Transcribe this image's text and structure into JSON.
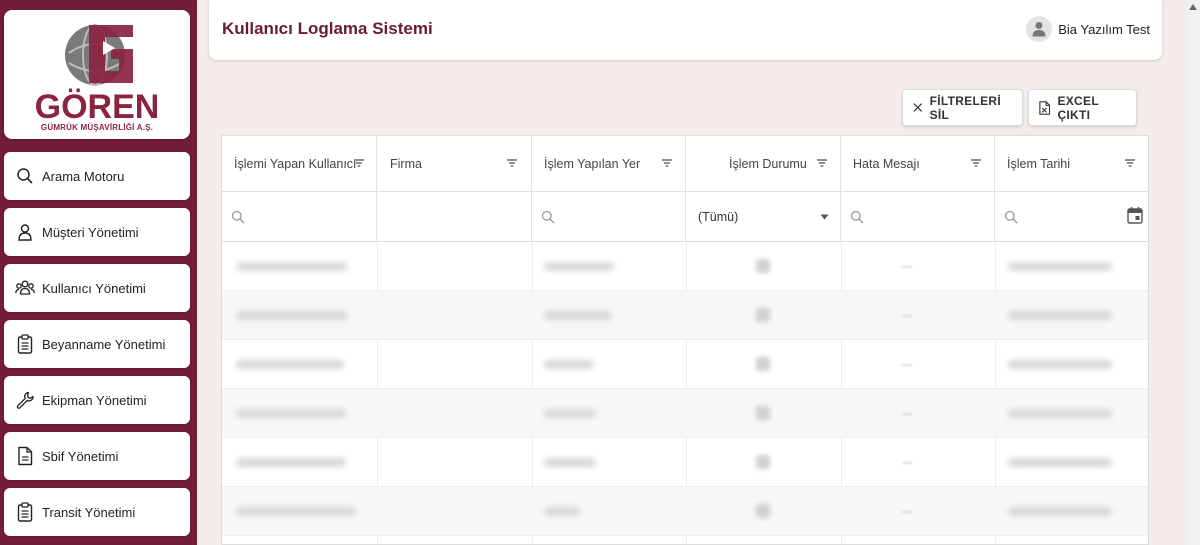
{
  "brand": {
    "name": "GÖREN",
    "subtitle": "GÜMRÜK MÜŞAVİRLİĞİ A.Ş.",
    "colors": {
      "primary": "#741d3b",
      "logo": "#8a2440"
    }
  },
  "sidebar": {
    "items": [
      {
        "label": "Arama Motoru",
        "icon": "search-icon"
      },
      {
        "label": "Müşteri Yönetimi",
        "icon": "person-icon"
      },
      {
        "label": "Kullanıcı Yönetimi",
        "icon": "users-icon"
      },
      {
        "label": "Beyanname Yönetimi",
        "icon": "clipboard-icon"
      },
      {
        "label": "Ekipman Yönetimi",
        "icon": "wrench-icon"
      },
      {
        "label": "Sbif Yönetimi",
        "icon": "document-icon"
      },
      {
        "label": "Transit Yönetimi",
        "icon": "clipboard-icon"
      }
    ]
  },
  "header": {
    "title": "Kullanıcı Loglama Sistemi",
    "user": "Bia Yazılım Test"
  },
  "toolbar": {
    "clear_filters": "FİLTRELERİ SİL",
    "excel_export": "EXCEL ÇIKTI"
  },
  "grid": {
    "columns": [
      {
        "label": "İşlemi Yapan Kullanıcı"
      },
      {
        "label": "Firma"
      },
      {
        "label": "İşlem Yapılan Yer"
      },
      {
        "label": "İşlem Durumu"
      },
      {
        "label": "Hata Mesajı"
      },
      {
        "label": "İşlem Tarihi"
      }
    ],
    "status_filter_value": "(Tümü)"
  }
}
